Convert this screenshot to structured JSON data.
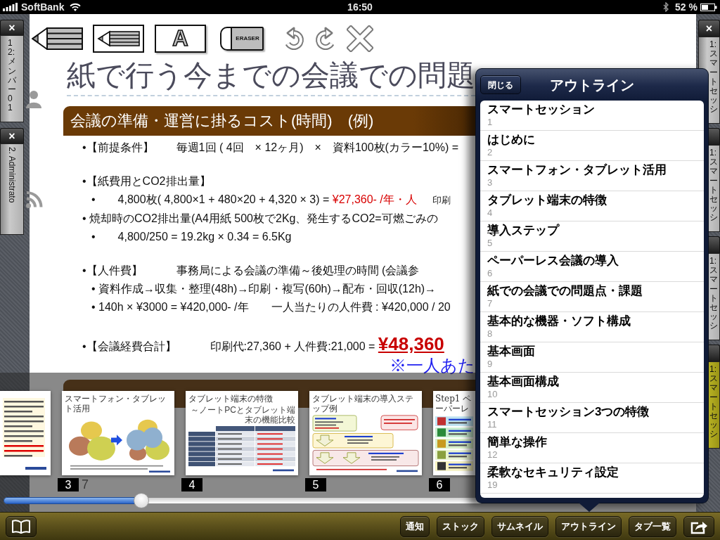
{
  "status_bar": {
    "carrier": "SoftBank",
    "time": "16:50",
    "battery": "52 %"
  },
  "left_tabs": [
    {
      "close": "×",
      "label": "12: メンバー01"
    },
    {
      "close": "×",
      "label": "2. Administrato"
    }
  ],
  "right_tabs": [
    {
      "close": "×",
      "label": "1:スマートセッシ",
      "selected": false
    },
    {
      "label": "1:スマートセッシ",
      "selected": false
    },
    {
      "label": "1:スマートセッシ",
      "selected": false
    },
    {
      "label": "1:スマートセッシ",
      "selected": true
    }
  ],
  "tools": [
    {
      "kind": "pen"
    },
    {
      "kind": "pencil"
    },
    {
      "kind": "text",
      "label": "A"
    },
    {
      "kind": "eraser",
      "label": "ERASER"
    },
    {
      "kind": "undo"
    },
    {
      "kind": "redo"
    },
    {
      "kind": "clear"
    }
  ],
  "slide": {
    "title": "紙で行う今までの会議での問題",
    "heading": "会議の準備・運営に掛るコスト(時間)　(例)",
    "bullet_groups": [
      {
        "items": [
          {
            "text": "•【前提条件】　　毎週1回 ( 4回　× 12ヶ月)　×　資料100枚(カラー10%) ="
          }
        ]
      },
      {
        "items": [
          {
            "text": "•【紙費用とCO2排出量】",
            "children": [
              {
                "segments": [
                  {
                    "text": "•　　4,800枚( 4,800×1 + 480×20 + 4,320 × 3) = "
                  },
                  {
                    "kind": "emphasis",
                    "text": "¥27,360- /年・人"
                  },
                  {
                    "kind": "aside",
                    "text": "印刷"
                  }
                ]
              }
            ]
          },
          {
            "text": "• 焼却時のCO2排出量(A4用紙 500枚で2Kg、発生するCO2=可燃ごみの",
            "children": [
              {
                "text": "•　　4,800/250 = 19.2kg × 0.34 = 6.5Kg"
              }
            ]
          }
        ]
      },
      {
        "items": [
          {
            "text": "•【人件費】　　　事務局による会議の準備～後処理の時間 (会議参",
            "children": [
              {
                "text": "• 資料作成→収集・整理(48h)→印刷・複写(60h)→配布・回収(12h)→"
              },
              {
                "text": "• 140h × ¥3000 = ¥420,000- /年　　一人当たりの人件費 : ¥420,000 / 20"
              }
            ]
          }
        ]
      },
      {
        "items": [
          {
            "segments": [
              {
                "text": "•【会議経費合計】　　　印刷代:27,360 + 人件費:21,000 = "
              },
              {
                "kind": "total",
                "text": "¥48,360"
              }
            ]
          }
        ]
      }
    ],
    "note": "※一人あた"
  },
  "thumbnails": [
    {
      "kind": "text-page"
    },
    {
      "kind": "diagram",
      "number": "3",
      "counter": "7",
      "title": "スマートフォン・タブレット活用"
    },
    {
      "kind": "table",
      "number": "4",
      "title": "タブレット端末の特徴",
      "subtitle": "～ノートPCとタブレット端末の機能比較"
    },
    {
      "kind": "steps",
      "number": "5",
      "title": "タブレット端末の導入ステップ例"
    },
    {
      "kind": "list",
      "number": "6",
      "title": "Step1 ペーパーレ"
    }
  ],
  "slider": {
    "level": 0.2
  },
  "outline": {
    "close_button": "閉じる",
    "title": "アウトライン",
    "items": [
      {
        "title": "スマートセッション",
        "page": "1"
      },
      {
        "title": "はじめに",
        "page": "2"
      },
      {
        "title": "スマートフォン・タブレット活用",
        "page": "3"
      },
      {
        "title": "タブレット端末の特徴",
        "page": "4"
      },
      {
        "title": "導入ステップ",
        "page": "5"
      },
      {
        "title": "ペーパーレス会議の導入",
        "page": "6"
      },
      {
        "title": "紙での会議での問題点・課題",
        "page": "7"
      },
      {
        "title": "基本的な機器・ソフト構成",
        "page": "8"
      },
      {
        "title": "基本画面",
        "page": "9"
      },
      {
        "title": "基本画面構成",
        "page": "10"
      },
      {
        "title": "スマートセッション3つの特徴",
        "page": "11"
      },
      {
        "title": "簡単な操作",
        "page": "12"
      },
      {
        "title": "柔軟なセキュリティ設定",
        "page": "19"
      }
    ]
  },
  "toolbar": {
    "left_button": {
      "kind": "book"
    },
    "buttons": [
      {
        "label": "通知"
      },
      {
        "label": "ストック"
      },
      {
        "label": "サムネイル"
      },
      {
        "label": "アウトライン"
      },
      {
        "label": "タブ一覧"
      }
    ],
    "right_button": {
      "kind": "share"
    }
  }
}
